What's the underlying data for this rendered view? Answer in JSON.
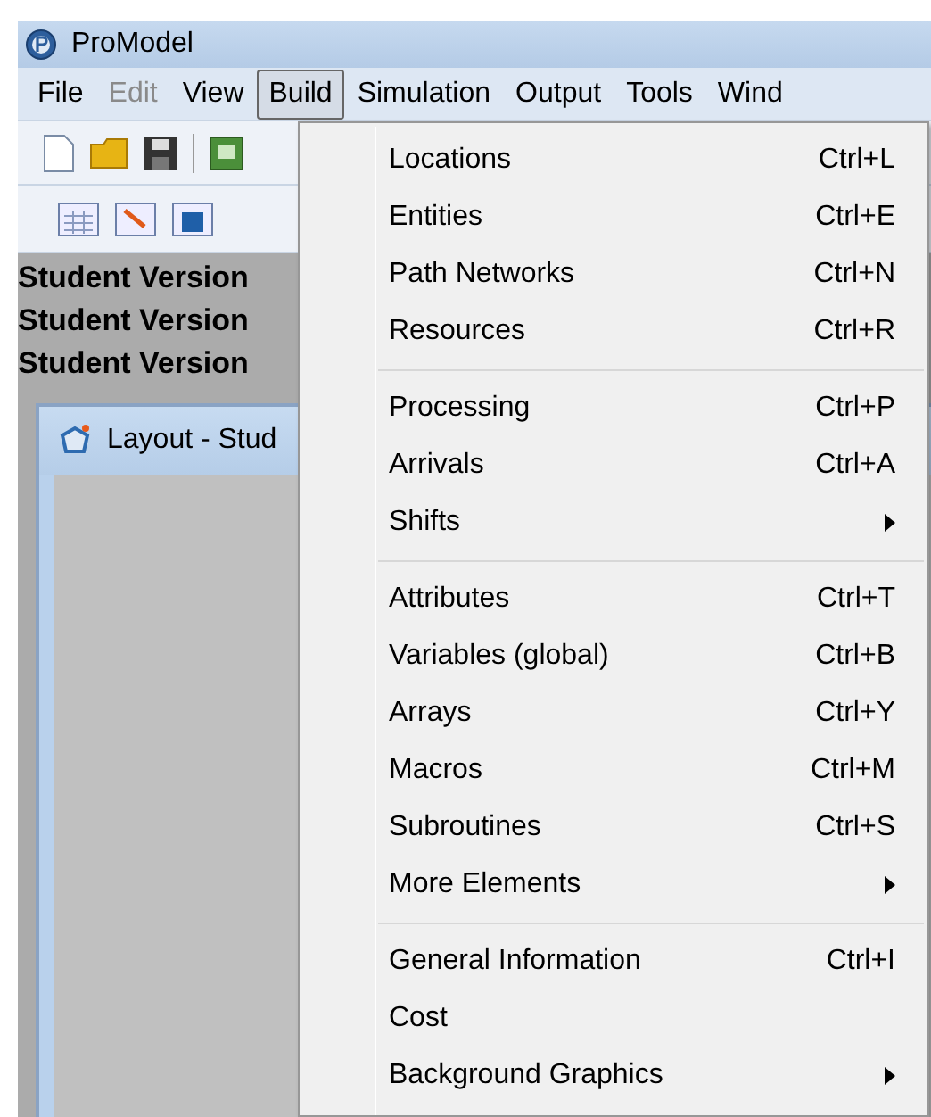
{
  "window": {
    "title": "ProModel"
  },
  "menubar": [
    {
      "label": "File",
      "selected": false,
      "disabled": false
    },
    {
      "label": "Edit",
      "selected": false,
      "disabled": true
    },
    {
      "label": "View",
      "selected": false,
      "disabled": false
    },
    {
      "label": "Build",
      "selected": true,
      "disabled": false
    },
    {
      "label": "Simulation",
      "selected": false,
      "disabled": false
    },
    {
      "label": "Output",
      "selected": false,
      "disabled": false
    },
    {
      "label": "Tools",
      "selected": false,
      "disabled": false
    },
    {
      "label": "Wind",
      "selected": false,
      "disabled": false
    }
  ],
  "background_lines": [
    "Student Version",
    "Student Version",
    "Student Version"
  ],
  "layout_window": {
    "title": "Layout - Stud"
  },
  "build_menu": [
    [
      {
        "label": "Locations",
        "kind": "shortcut",
        "shortcut": "Ctrl+L"
      },
      {
        "label": "Entities",
        "kind": "shortcut",
        "shortcut": "Ctrl+E"
      },
      {
        "label": "Path Networks",
        "kind": "shortcut",
        "shortcut": "Ctrl+N"
      },
      {
        "label": "Resources",
        "kind": "shortcut",
        "shortcut": "Ctrl+R"
      }
    ],
    [
      {
        "label": "Processing",
        "kind": "shortcut",
        "shortcut": "Ctrl+P"
      },
      {
        "label": "Arrivals",
        "kind": "shortcut",
        "shortcut": "Ctrl+A"
      },
      {
        "label": "Shifts",
        "kind": "submenu"
      }
    ],
    [
      {
        "label": "Attributes",
        "kind": "shortcut",
        "shortcut": "Ctrl+T"
      },
      {
        "label": "Variables (global)",
        "kind": "shortcut",
        "shortcut": "Ctrl+B"
      },
      {
        "label": "Arrays",
        "kind": "shortcut",
        "shortcut": "Ctrl+Y"
      },
      {
        "label": "Macros",
        "kind": "shortcut",
        "shortcut": "Ctrl+M"
      },
      {
        "label": "Subroutines",
        "kind": "shortcut",
        "shortcut": "Ctrl+S"
      },
      {
        "label": "More Elements",
        "kind": "submenu"
      }
    ],
    [
      {
        "label": "General Information",
        "kind": "shortcut",
        "shortcut": "Ctrl+I"
      },
      {
        "label": "Cost",
        "kind": "plain"
      },
      {
        "label": "Background Graphics",
        "kind": "submenu"
      }
    ]
  ]
}
